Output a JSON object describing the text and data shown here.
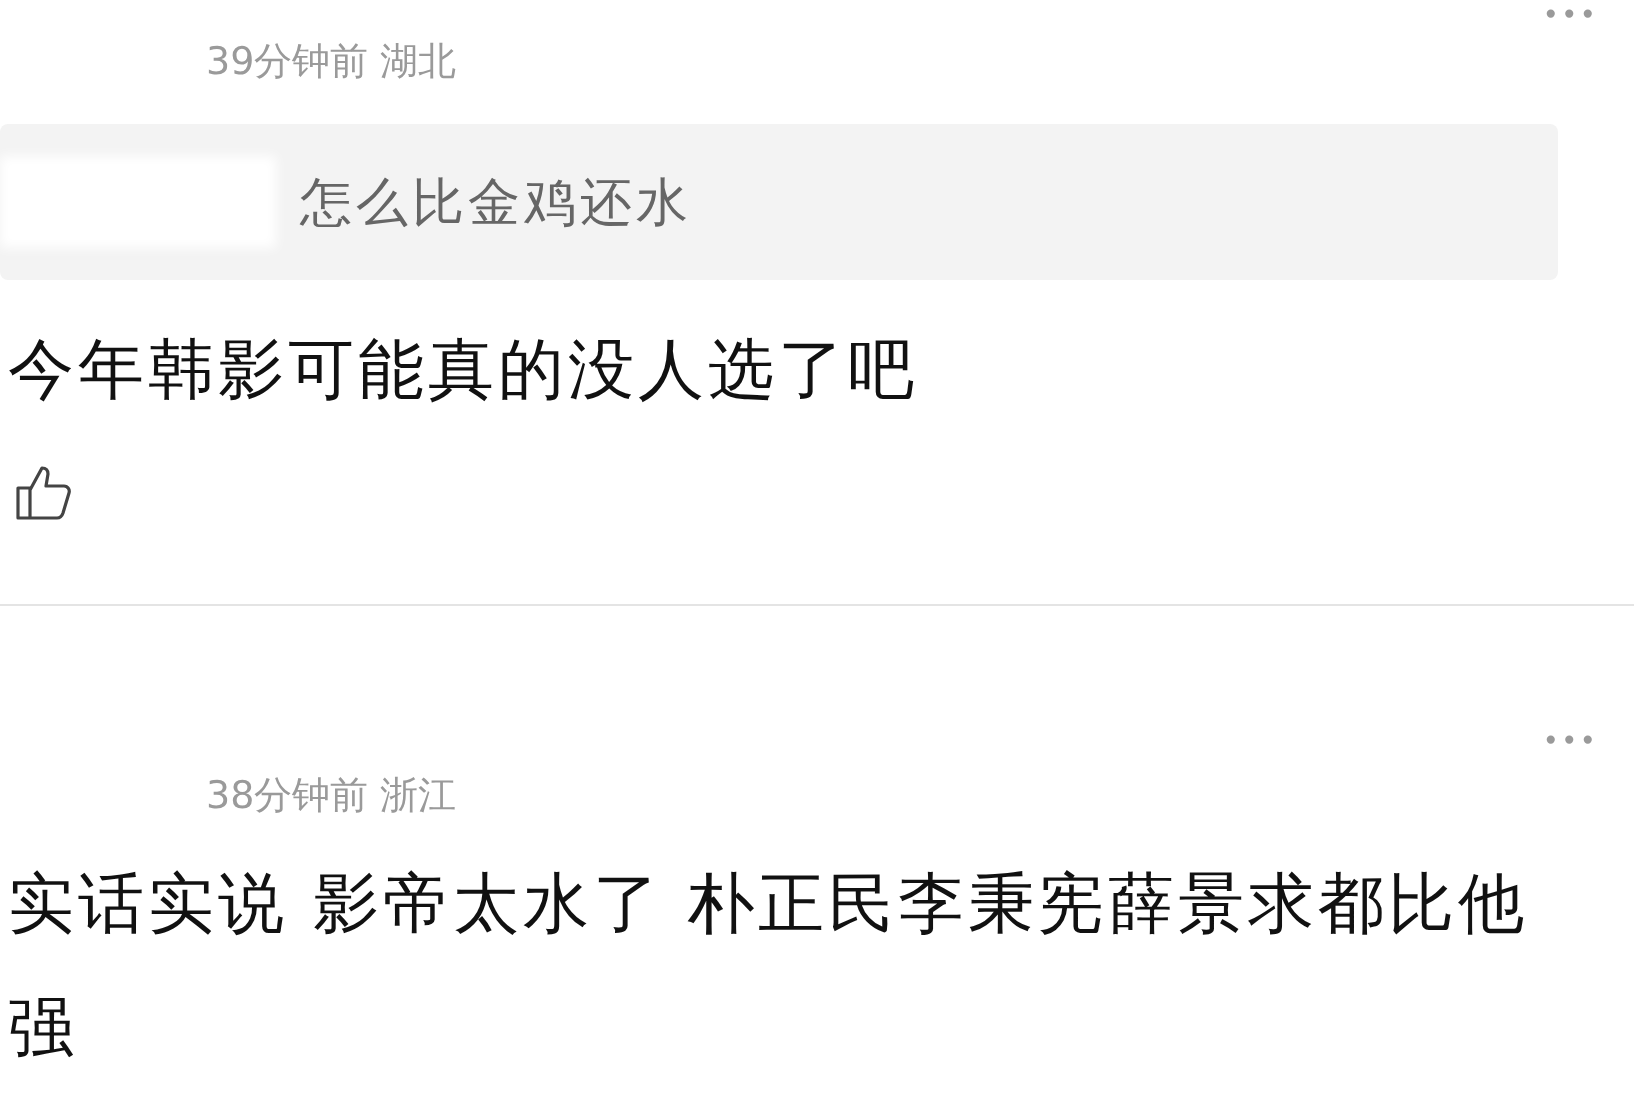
{
  "comments": [
    {
      "meta": "39分钟前 湖北",
      "quote": "怎么比金鸡还水",
      "text": "今年韩影可能真的没人选了吧",
      "liked": false,
      "menu": "•••"
    },
    {
      "meta": "38分钟前 浙江",
      "text": "实话实说 影帝太水了 朴正民李秉宪薛景求都比他强",
      "menu": "•••"
    }
  ]
}
